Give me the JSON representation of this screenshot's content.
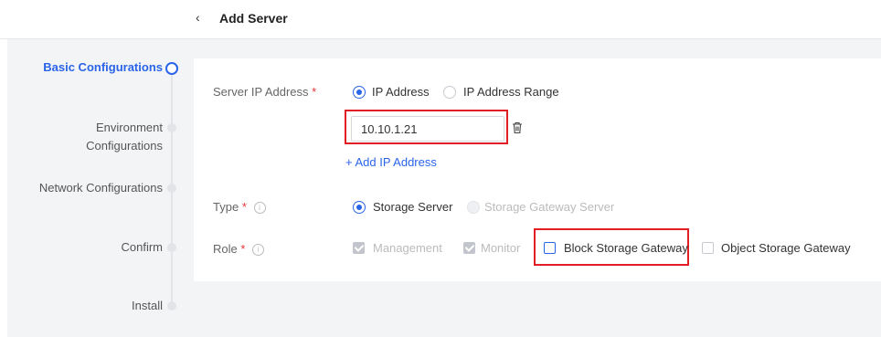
{
  "header": {
    "back_icon": "chevron-left",
    "title": "Add Server"
  },
  "steps": [
    {
      "label": "Basic Configurations",
      "active": true
    },
    {
      "label_line1": "Environment",
      "label_line2": "Configurations"
    },
    {
      "label": "Network Configurations"
    },
    {
      "label": "Confirm"
    },
    {
      "label": "Install"
    }
  ],
  "form": {
    "server_ip": {
      "label": "Server IP Address",
      "required_mark": "*",
      "options": [
        "IP Address",
        "IP Address Range"
      ],
      "selected": "IP Address",
      "input_value": "10.10.1.21",
      "delete_icon": "trash-icon",
      "add_link": "+ Add IP Address"
    },
    "type": {
      "label": "Type",
      "required_mark": "*",
      "info_icon": "i",
      "options": [
        "Storage Server",
        "Storage Gateway Server"
      ],
      "selected": "Storage Server"
    },
    "role": {
      "label": "Role",
      "required_mark": "*",
      "info_icon": "i",
      "options": [
        "Management",
        "Monitor",
        "Block Storage Gateway",
        "Object Storage Gateway"
      ]
    }
  },
  "colors": {
    "accent": "#2a64e8",
    "highlight": "#e01e24",
    "required": "#e8353a"
  }
}
